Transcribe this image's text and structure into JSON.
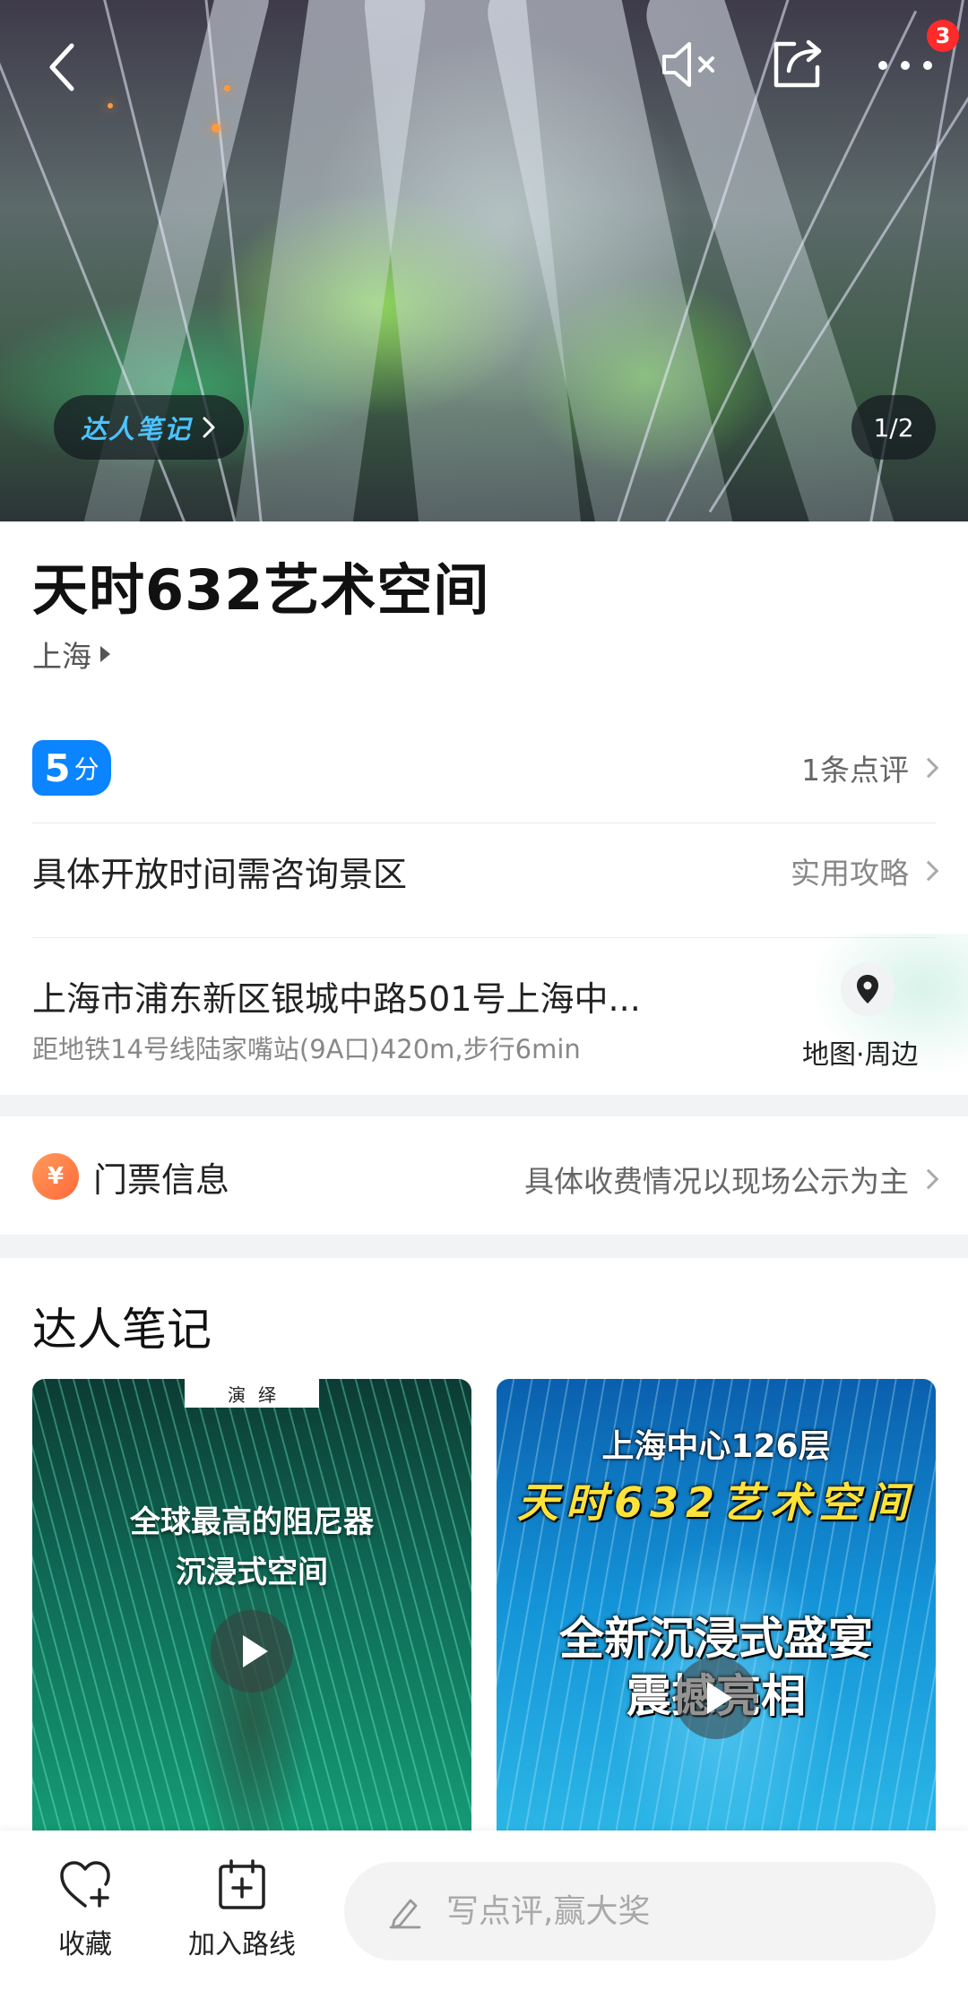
{
  "hero": {
    "daren_label": "达人笔记",
    "counter": "1/2",
    "notification_count": "3"
  },
  "place": {
    "title": "天时632艺术空间",
    "city": "上海"
  },
  "rating": {
    "score": "5",
    "unit": "分",
    "reviews": "1条点评"
  },
  "hours": {
    "text": "具体开放时间需咨询景区",
    "guide_link": "实用攻略"
  },
  "address": {
    "main": "上海市浦东新区银城中路501号上海中...",
    "sub": "距地铁14号线陆家嘴站(9A口)420m,步行6min",
    "map_label": "地图·周边"
  },
  "ticket": {
    "icon_symbol": "¥",
    "title": "门票信息",
    "detail": "具体收费情况以现场公示为主"
  },
  "notes": {
    "title": "达人笔记",
    "cards": [
      {
        "tag": "演绎",
        "line1": "全球最高的阻尼器",
        "line2": "沉浸式空间"
      },
      {
        "line1": "上海中心126层",
        "line2": "天时632艺术空间",
        "line3": "全新沉浸式盛宴",
        "line4": "震撼亮相"
      }
    ]
  },
  "bottombar": {
    "favorite": "收藏",
    "add_route": "加入路线",
    "comment_placeholder": "写点评,赢大奖"
  }
}
